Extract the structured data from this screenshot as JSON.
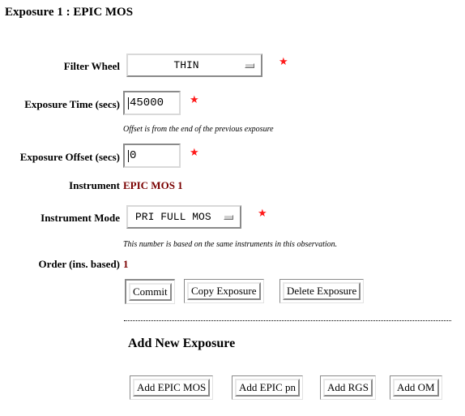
{
  "page": {
    "title": "Exposure 1 : EPIC MOS"
  },
  "form": {
    "filter_wheel": {
      "label": "Filter Wheel",
      "selected": "THIN",
      "required": true
    },
    "exposure_time": {
      "label": "Exposure Time (secs)",
      "value": "45000",
      "required": true
    },
    "offset_note": "Offset is from the end of the previous exposure",
    "exposure_offset": {
      "label": "Exposure Offset (secs)",
      "value": "0",
      "required": true
    },
    "instrument": {
      "label": "Instrument",
      "value": "EPIC MOS 1"
    },
    "instrument_mode": {
      "label": "Instrument Mode",
      "selected": "PRI FULL MOS",
      "required": true
    },
    "order_note": "This number is based on the same instruments in this observation.",
    "order": {
      "label": "Order (ins. based)",
      "value": "1"
    },
    "required_marker": "★"
  },
  "actions": {
    "commit": "Commit",
    "copy": "Copy Exposure",
    "delete": "Delete Exposure"
  },
  "add_section": {
    "heading": "Add New Exposure",
    "buttons": [
      "Add EPIC MOS",
      "Add EPIC pn",
      "Add RGS",
      "Add OM"
    ]
  },
  "colors": {
    "required_star": "#ff1a1a",
    "value_text": "#7a0000"
  }
}
